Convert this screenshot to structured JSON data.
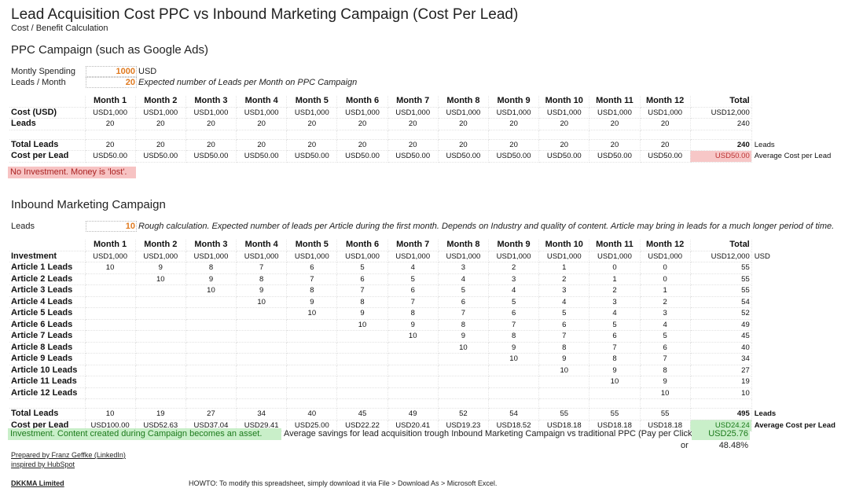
{
  "header": {
    "title": "Lead Acquisition Cost PPC vs Inbound Marketing Campaign (Cost Per Lead)",
    "subtitle": "Cost / Benefit Calculation"
  },
  "ppc": {
    "heading": "PPC Campaign (such as Google Ads)",
    "inputs": {
      "spending_label": "Montly Spending",
      "spending_value": "1000",
      "spending_unit": "USD",
      "leads_label": "Leads / Month",
      "leads_value": "20",
      "leads_note": "Expected number of Leads per Month on PPC Campaign"
    },
    "columns": [
      "Month 1",
      "Month 2",
      "Month 3",
      "Month 4",
      "Month 5",
      "Month 6",
      "Month 7",
      "Month 8",
      "Month 9",
      "Month 10",
      "Month 11",
      "Month 12",
      "Total"
    ],
    "rows": {
      "cost_label": "Cost (USD)",
      "cost": [
        "USD1,000",
        "USD1,000",
        "USD1,000",
        "USD1,000",
        "USD1,000",
        "USD1,000",
        "USD1,000",
        "USD1,000",
        "USD1,000",
        "USD1,000",
        "USD1,000",
        "USD1,000",
        "USD12,000"
      ],
      "leads_label": "Leads",
      "leads": [
        "20",
        "20",
        "20",
        "20",
        "20",
        "20",
        "20",
        "20",
        "20",
        "20",
        "20",
        "20",
        "240"
      ],
      "total_leads_label": "Total Leads",
      "total_leads": [
        "20",
        "20",
        "20",
        "20",
        "20",
        "20",
        "20",
        "20",
        "20",
        "20",
        "20",
        "20",
        "240"
      ],
      "total_leads_suffix": "Leads",
      "cpl_label": "Cost per Lead",
      "cpl": [
        "USD50.00",
        "USD50.00",
        "USD50.00",
        "USD50.00",
        "USD50.00",
        "USD50.00",
        "USD50.00",
        "USD50.00",
        "USD50.00",
        "USD50.00",
        "USD50.00",
        "USD50.00",
        "USD50.00"
      ],
      "cpl_suffix": "Average Cost per Lead"
    },
    "note": "No Investment. Money is 'lost'.",
    "colors": {
      "note_bg": "#f7c3c3",
      "highlight": "#f7c7c7"
    }
  },
  "inbound": {
    "heading": "Inbound Marketing Campaign",
    "inputs": {
      "leads_label": "Leads",
      "leads_value": "10",
      "leads_note": "Rough calculation. Expected number of leads per Article during the first month. Depends on Industry and quality of content. Article may bring in leads for a much longer period of time."
    },
    "columns": [
      "Month 1",
      "Month 2",
      "Month 3",
      "Month 4",
      "Month 5",
      "Month 6",
      "Month 7",
      "Month 8",
      "Month 9",
      "Month 10",
      "Month 11",
      "Month 12",
      "Total"
    ],
    "investment_label": "Investment",
    "investment": [
      "USD1,000",
      "USD1,000",
      "USD1,000",
      "USD1,000",
      "USD1,000",
      "USD1,000",
      "USD1,000",
      "USD1,000",
      "USD1,000",
      "USD1,000",
      "USD1,000",
      "USD1,000",
      "USD12,000"
    ],
    "investment_suffix": "USD",
    "articles": [
      {
        "label": "Article 1 Leads",
        "values": [
          "10",
          "9",
          "8",
          "7",
          "6",
          "5",
          "4",
          "3",
          "2",
          "1",
          "0",
          "0",
          "55"
        ]
      },
      {
        "label": "Article 2 Leads",
        "values": [
          "",
          "10",
          "9",
          "8",
          "7",
          "6",
          "5",
          "4",
          "3",
          "2",
          "1",
          "0",
          "55"
        ]
      },
      {
        "label": "Article 3 Leads",
        "values": [
          "",
          "",
          "10",
          "9",
          "8",
          "7",
          "6",
          "5",
          "4",
          "3",
          "2",
          "1",
          "55"
        ]
      },
      {
        "label": "Article 4 Leads",
        "values": [
          "",
          "",
          "",
          "10",
          "9",
          "8",
          "7",
          "6",
          "5",
          "4",
          "3",
          "2",
          "54"
        ]
      },
      {
        "label": "Article 5 Leads",
        "values": [
          "",
          "",
          "",
          "",
          "10",
          "9",
          "8",
          "7",
          "6",
          "5",
          "4",
          "3",
          "52"
        ]
      },
      {
        "label": "Article 6 Leads",
        "values": [
          "",
          "",
          "",
          "",
          "",
          "10",
          "9",
          "8",
          "7",
          "6",
          "5",
          "4",
          "49"
        ]
      },
      {
        "label": "Article 7 Leads",
        "values": [
          "",
          "",
          "",
          "",
          "",
          "",
          "10",
          "9",
          "8",
          "7",
          "6",
          "5",
          "45"
        ]
      },
      {
        "label": "Article 8 Leads",
        "values": [
          "",
          "",
          "",
          "",
          "",
          "",
          "",
          "10",
          "9",
          "8",
          "7",
          "6",
          "40"
        ]
      },
      {
        "label": "Article 9 Leads",
        "values": [
          "",
          "",
          "",
          "",
          "",
          "",
          "",
          "",
          "10",
          "9",
          "8",
          "7",
          "34"
        ]
      },
      {
        "label": "Article 10 Leads",
        "values": [
          "",
          "",
          "",
          "",
          "",
          "",
          "",
          "",
          "",
          "10",
          "9",
          "8",
          "27"
        ]
      },
      {
        "label": "Article 11 Leads",
        "values": [
          "",
          "",
          "",
          "",
          "",
          "",
          "",
          "",
          "",
          "",
          "10",
          "9",
          "19"
        ]
      },
      {
        "label": "Article 12 Leads",
        "values": [
          "",
          "",
          "",
          "",
          "",
          "",
          "",
          "",
          "",
          "",
          "",
          "10",
          "10"
        ]
      }
    ],
    "total_leads_label": "Total Leads",
    "total_leads": [
      "10",
      "19",
      "27",
      "34",
      "40",
      "45",
      "49",
      "52",
      "54",
      "55",
      "55",
      "55",
      "495"
    ],
    "total_leads_suffix": "Leads",
    "cpl_label": "Cost per Lead",
    "cpl": [
      "USD100.00",
      "USD52.63",
      "USD37.04",
      "USD29.41",
      "USD25.00",
      "USD22.22",
      "USD20.41",
      "USD19.23",
      "USD18.52",
      "USD18.18",
      "USD18.18",
      "USD18.18",
      "USD24.24"
    ],
    "cpl_suffix": "Average Cost per Lead",
    "note": "Investment. Content created during Campaign becomes an asset.",
    "savings_text": "Average savings for lead acquisition trough Inbound Marketing Campaign vs traditional PPC (Pay per Click)",
    "savings_value": "USD25.76",
    "or_label": "or",
    "savings_percent": "48.48%",
    "colors": {
      "note_bg": "#c9efc9",
      "highlight": "#c9efc9"
    }
  },
  "footer": {
    "prepared_by": "Prepared by Franz Geffke (LinkedIn)",
    "inspired_by": "inspired by HubSpot",
    "company": "DKKMA Limited",
    "howto": "HOWTO: To modify this spreadsheet, simply download it via File > Download As > Microsoft Excel."
  }
}
